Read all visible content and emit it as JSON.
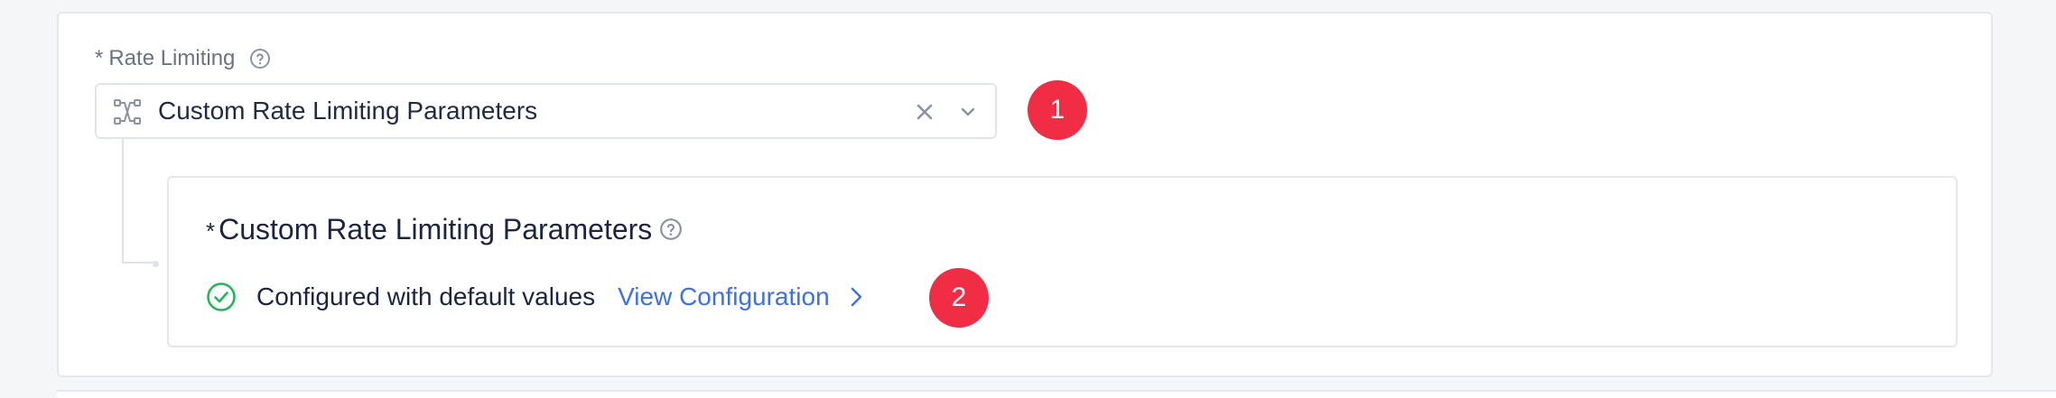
{
  "rate_limiting": {
    "required_mark": "*",
    "label": "Rate Limiting",
    "selected_value": "Custom Rate Limiting Parameters"
  },
  "custom_params": {
    "required_mark": "*",
    "title": "Custom Rate Limiting Parameters",
    "status_text": "Configured with default values",
    "view_link": "View Configuration"
  },
  "badges": {
    "first": "1",
    "second": "2"
  },
  "colors": {
    "badge": "#f02d45",
    "link": "#3f6fe6",
    "success": "#22b55a",
    "text": "#1c2540",
    "muted": "#6b7280"
  }
}
